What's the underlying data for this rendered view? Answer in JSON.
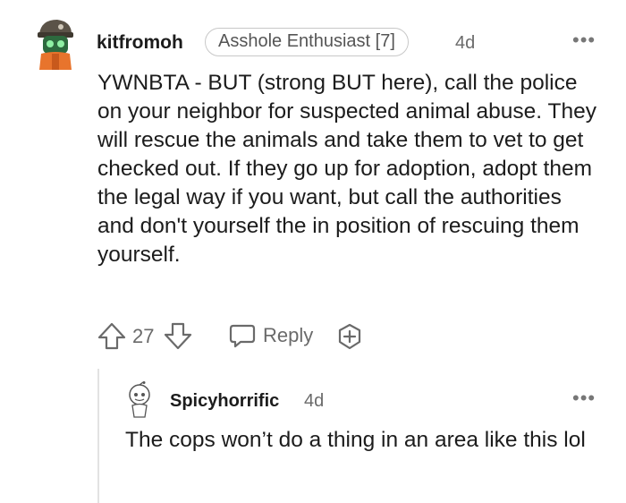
{
  "comment": {
    "username": "kitfromoh",
    "flair": "Asshole Enthusiast [7]",
    "timestamp": "4d",
    "more_label": "•••",
    "body": "YWNBTA - BUT (strong BUT here), call the police on your neighbor for suspected animal abuse. They will rescue the animals and take them to vet to get checked out. If they go up for adoption, adopt them the legal way if you want, but call the authorities and don't yourself the in position of rescuing them yourself.",
    "vote_count": "27",
    "reply_label": "Reply",
    "upvote_icon": "upvote-arrow-icon",
    "downvote_icon": "downvote-arrow-icon",
    "reply_icon": "speech-bubble-icon",
    "award_icon": "add-award-icon"
  },
  "reply": {
    "username": "Spicyhorrific",
    "timestamp": "4d",
    "more_label": "•••",
    "body": "The cops won’t do a thing in an area like this lol"
  },
  "colors": {
    "text": "#1c1c1c",
    "meta": "#6a6a6a",
    "flair_border": "#c8c8c8",
    "thread_line": "#e2e2e2"
  }
}
